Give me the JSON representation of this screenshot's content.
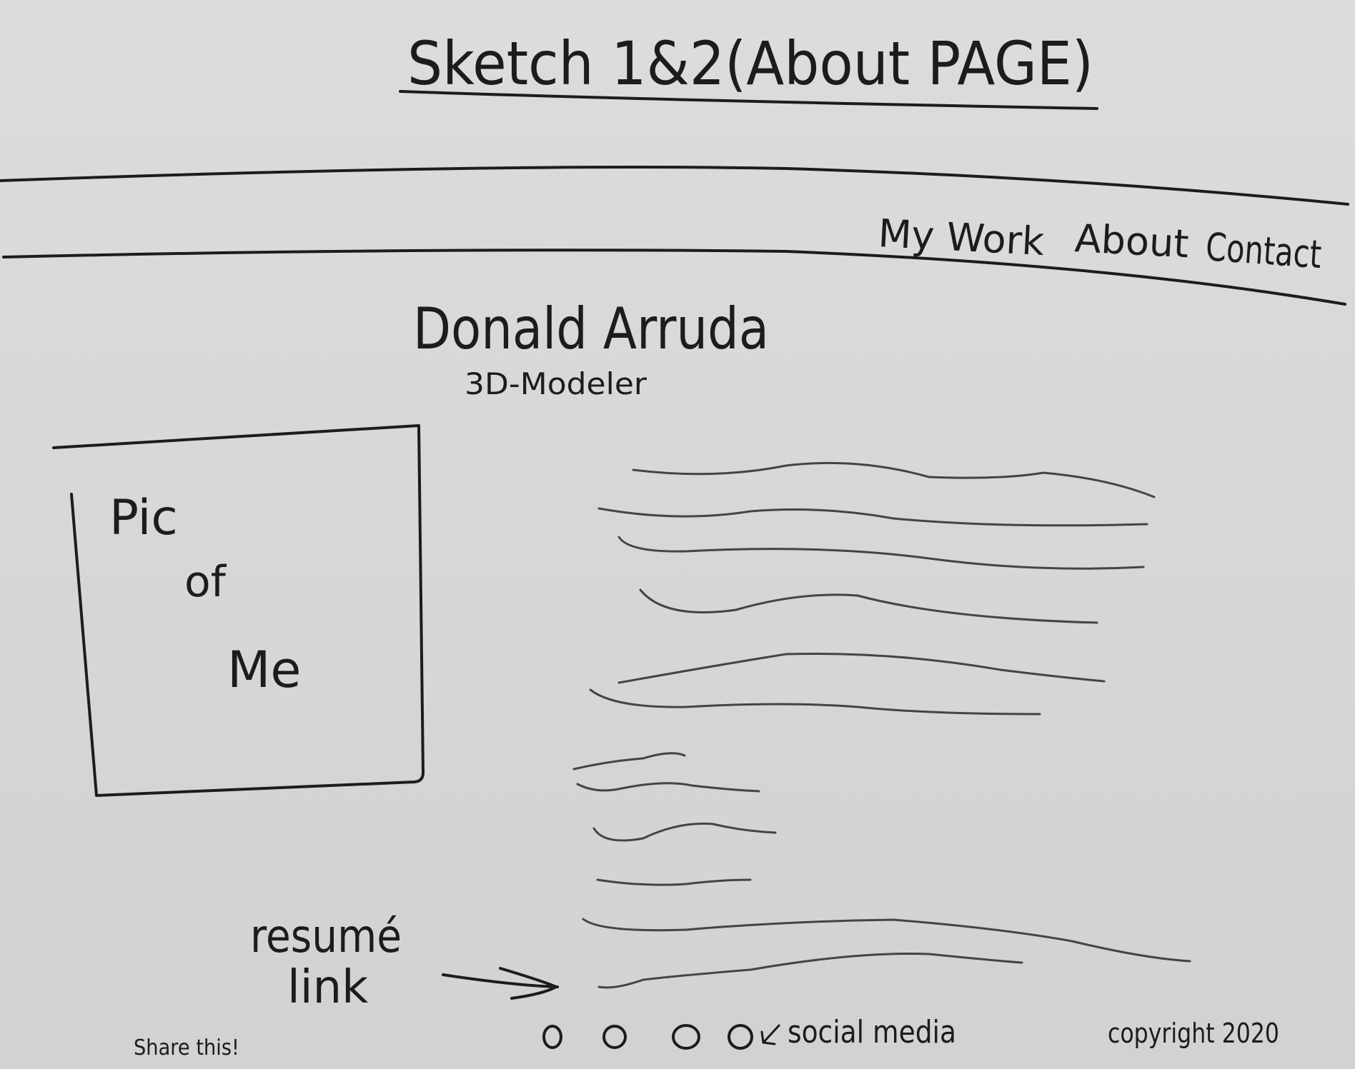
{
  "sketch_title": "Sketch 1&2(About PAGE)",
  "nav": {
    "items": [
      {
        "label": "My Work"
      },
      {
        "label": "About"
      },
      {
        "label": "Contact"
      }
    ]
  },
  "profile": {
    "name": "Donald Arruda",
    "role": "3D-Modeler"
  },
  "photo_placeholder": {
    "line1": "Pic",
    "line2": "of",
    "line3": "Me"
  },
  "resume": {
    "line1": "resumé",
    "line2": "link"
  },
  "footer": {
    "share_label": "Share this!",
    "social_label": "social media",
    "copyright": "copyright 2020"
  },
  "social_icons": [
    {
      "icon": "circle-icon"
    },
    {
      "icon": "circle-icon"
    },
    {
      "icon": "circle-icon"
    },
    {
      "icon": "circle-icon"
    }
  ]
}
